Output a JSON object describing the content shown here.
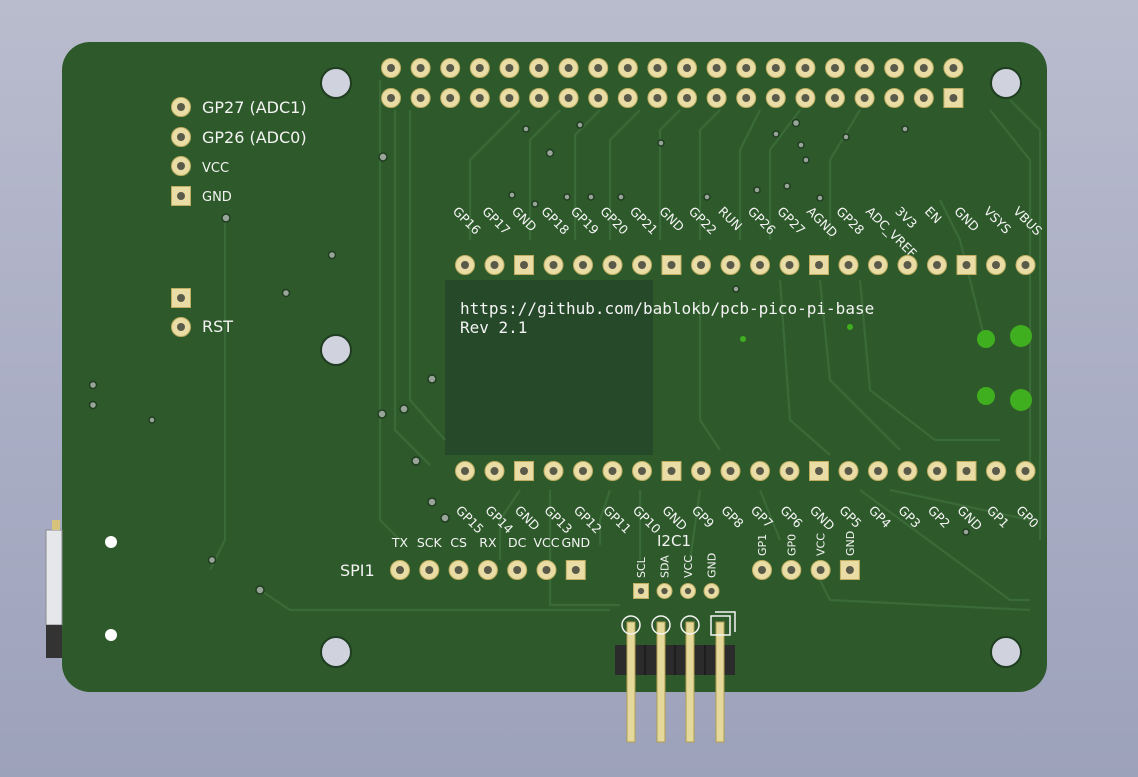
{
  "board": {
    "url": "https://github.com/bablokb/pcb-pico-pi-base",
    "revision": "Rev 2.1",
    "colors": {
      "pcb": "#2e5a2b",
      "trace": "#3a6a37",
      "silk": "#f4f4f4",
      "pad": "#e9dca4",
      "zone": "#25472a"
    }
  },
  "left_header": {
    "labels": [
      "GP27 (ADC1)",
      "GP26 (ADC0)",
      "VCC",
      "GND"
    ]
  },
  "reset": {
    "label": "RST"
  },
  "pico_top_labels": [
    "GP16",
    "GP17",
    "GND",
    "GP18",
    "GP19",
    "GP20",
    "GP21",
    "GND",
    "GP22",
    "RUN",
    "GP26",
    "GP27",
    "AGND",
    "GP28",
    "ADC_VREF",
    "3V3",
    "EN",
    "GND",
    "VSYS",
    "VBUS"
  ],
  "pico_bottom_labels": [
    "GP15",
    "GP14",
    "GND",
    "GP13",
    "GP12",
    "GP11",
    "GP10",
    "GND",
    "GP9",
    "GP8",
    "GP7",
    "GP6",
    "GND",
    "GP5",
    "GP4",
    "GP3",
    "GP2",
    "GND",
    "GP1",
    "GP0"
  ],
  "spi": {
    "name": "SPI1",
    "labels": [
      "TX",
      "SCK",
      "CS",
      "RX",
      "DC",
      "VCC",
      "GND"
    ]
  },
  "i2c": {
    "name": "I2C1",
    "labels": [
      "SCL",
      "SDA",
      "VCC",
      "GND"
    ]
  },
  "uart": {
    "labels": [
      "GP1",
      "GP0",
      "VCC",
      "GND"
    ]
  }
}
